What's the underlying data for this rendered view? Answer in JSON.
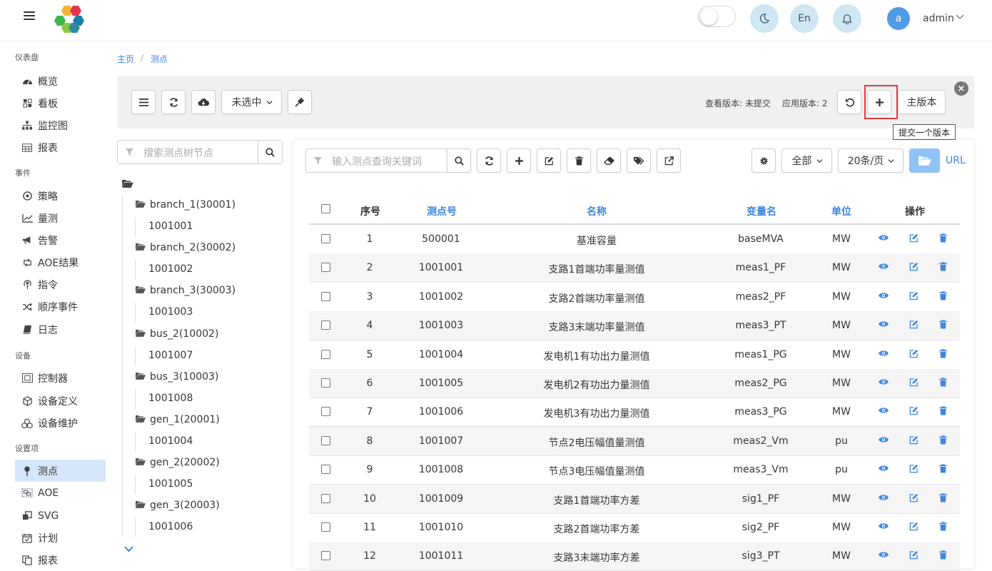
{
  "header": {
    "lang_label": "En",
    "avatar_letter": "a",
    "username": "admin"
  },
  "sidebar": {
    "sections": [
      {
        "label": "仪表盘",
        "items": [
          {
            "label": "概览",
            "icon": "dashboard-icon"
          },
          {
            "label": "看板",
            "icon": "board-icon"
          },
          {
            "label": "监控图",
            "icon": "sitemap-icon"
          },
          {
            "label": "报表",
            "icon": "table-icon"
          }
        ]
      },
      {
        "label": "事件",
        "items": [
          {
            "label": "策略",
            "icon": "target-icon"
          },
          {
            "label": "量测",
            "icon": "chart-line-icon"
          },
          {
            "label": "告警",
            "icon": "bullhorn-icon"
          },
          {
            "label": "AOE结果",
            "icon": "retweet-icon"
          },
          {
            "label": "指令",
            "icon": "podcast-icon"
          },
          {
            "label": "顺序事件",
            "icon": "random-icon"
          },
          {
            "label": "日志",
            "icon": "book-icon"
          }
        ]
      },
      {
        "label": "设备",
        "items": [
          {
            "label": "控制器",
            "icon": "chip-icon"
          },
          {
            "label": "设备定义",
            "icon": "cube-icon"
          },
          {
            "label": "设备维护",
            "icon": "cubes-icon"
          }
        ]
      },
      {
        "label": "设置项",
        "items": [
          {
            "label": "测点",
            "icon": "map-pin-icon",
            "active": true
          },
          {
            "label": "AOE",
            "icon": "object-group-icon"
          },
          {
            "label": "SVG",
            "icon": "clone-icon"
          },
          {
            "label": "计划",
            "icon": "calendar-check-icon"
          },
          {
            "label": "报表",
            "icon": "copy-icon"
          }
        ]
      }
    ]
  },
  "breadcrumb": {
    "home": "主页",
    "current": "测点",
    "separator": "/"
  },
  "toolbar": {
    "select_label": "未选中",
    "view_version": "查看版本: 未提交",
    "apply_version": "应用版本: 2",
    "main_version_label": "主版本",
    "submit_tooltip": "提交一个版本"
  },
  "tree": {
    "search_placeholder": "搜索测点树节点",
    "nodes": [
      {
        "label": "branch_1(30001)",
        "children": [
          "1001001"
        ]
      },
      {
        "label": "branch_2(30002)",
        "children": [
          "1001002"
        ]
      },
      {
        "label": "branch_3(30003)",
        "children": [
          "1001003"
        ]
      },
      {
        "label": "bus_2(10002)",
        "children": [
          "1001007"
        ]
      },
      {
        "label": "bus_3(10003)",
        "children": [
          "1001008"
        ]
      },
      {
        "label": "gen_1(20001)",
        "children": [
          "1001004"
        ]
      },
      {
        "label": "gen_2(20002)",
        "children": [
          "1001005"
        ]
      },
      {
        "label": "gen_3(20003)",
        "children": [
          "1001006"
        ]
      }
    ]
  },
  "table": {
    "search_placeholder": "输入测点查询关键词",
    "filter_label": "全部",
    "page_size_label": "20条/页",
    "url_label": "URL",
    "columns": [
      "序号",
      "测点号",
      "名称",
      "变量名",
      "单位",
      "操作"
    ],
    "rows": [
      [
        "1",
        "500001",
        "基准容量",
        "baseMVA",
        "MW"
      ],
      [
        "2",
        "1001001",
        "支路1首端功率量测值",
        "meas1_PF",
        "MW"
      ],
      [
        "3",
        "1001002",
        "支路2首端功率量测值",
        "meas2_PF",
        "MW"
      ],
      [
        "4",
        "1001003",
        "支路3末端功率量测值",
        "meas3_PT",
        "MW"
      ],
      [
        "5",
        "1001004",
        "发电机1有功出力量测值",
        "meas1_PG",
        "MW"
      ],
      [
        "6",
        "1001005",
        "发电机2有功出力量测值",
        "meas2_PG",
        "MW"
      ],
      [
        "7",
        "1001006",
        "发电机3有功出力量测值",
        "meas3_PG",
        "MW"
      ],
      [
        "8",
        "1001007",
        "节点2电压幅值量测值",
        "meas2_Vm",
        "pu"
      ],
      [
        "9",
        "1001008",
        "节点3电压幅值量测值",
        "meas3_Vm",
        "pu"
      ],
      [
        "10",
        "1001009",
        "支路1首端功率方差",
        "sig1_PF",
        "MW"
      ],
      [
        "11",
        "1001010",
        "支路2首端功率方差",
        "sig2_PF",
        "MW"
      ],
      [
        "12",
        "1001011",
        "支路3末端功率方差",
        "sig3_PT",
        "MW"
      ]
    ]
  },
  "colors": {
    "accent": "#3e86e0",
    "active_menu": "#d5e6fa",
    "highlight": "#e23c3c",
    "icon_circle": "#cfe6f3"
  }
}
